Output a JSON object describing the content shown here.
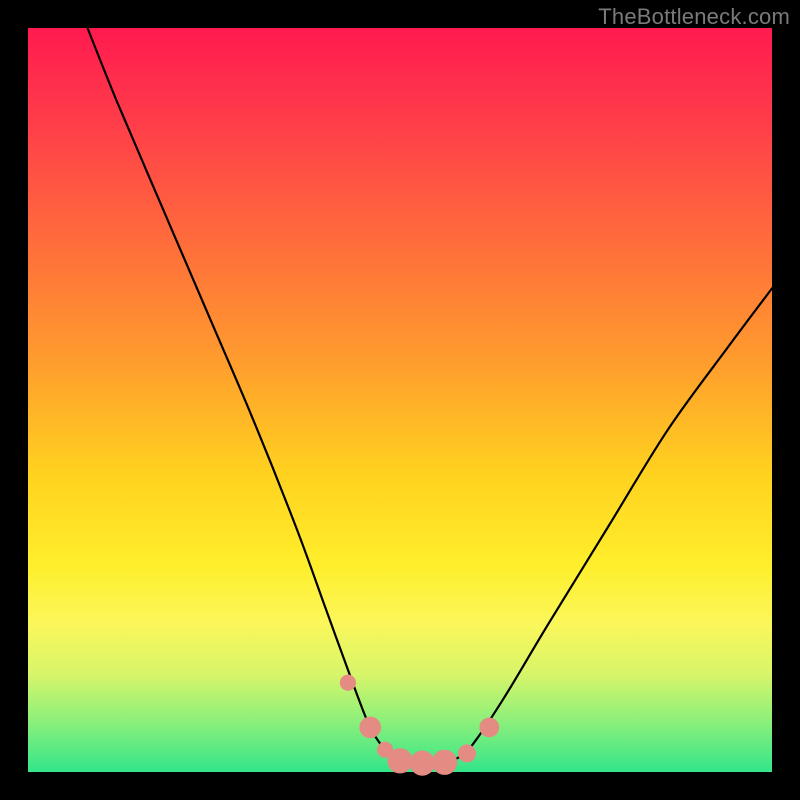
{
  "watermark": "TheBottleneck.com",
  "chart_data": {
    "type": "line",
    "title": "",
    "xlabel": "",
    "ylabel": "",
    "xlim": [
      0,
      100
    ],
    "ylim": [
      0,
      100
    ],
    "series": [
      {
        "name": "bottleneck-curve",
        "x": [
          8,
          12,
          18,
          24,
          30,
          36,
          40,
          44,
          46,
          48,
          50,
          52,
          55,
          58,
          60,
          64,
          70,
          78,
          86,
          94,
          100
        ],
        "values": [
          100,
          90,
          76,
          62,
          48,
          33,
          22,
          11,
          6,
          3,
          1.5,
          1.2,
          1.2,
          2,
          4,
          10,
          20,
          33,
          46,
          57,
          65
        ]
      }
    ],
    "markers": {
      "name": "highlight-dots",
      "color": "#e48b84",
      "points": [
        {
          "x": 43,
          "y": 12,
          "r": 1.8
        },
        {
          "x": 46,
          "y": 6,
          "r": 2.4
        },
        {
          "x": 48,
          "y": 3,
          "r": 1.8
        },
        {
          "x": 50,
          "y": 1.5,
          "r": 2.8
        },
        {
          "x": 53,
          "y": 1.2,
          "r": 2.8
        },
        {
          "x": 56,
          "y": 1.3,
          "r": 2.8
        },
        {
          "x": 59,
          "y": 2.5,
          "r": 2.0
        },
        {
          "x": 62,
          "y": 6,
          "r": 2.2
        }
      ]
    },
    "gradient_stops": [
      {
        "offset": 0,
        "color": "#ff1a4f"
      },
      {
        "offset": 12,
        "color": "#ff3b4a"
      },
      {
        "offset": 28,
        "color": "#ff6a3c"
      },
      {
        "offset": 44,
        "color": "#ff9a2e"
      },
      {
        "offset": 60,
        "color": "#ffd21f"
      },
      {
        "offset": 72,
        "color": "#ffee2b"
      },
      {
        "offset": 80,
        "color": "#fbf75a"
      },
      {
        "offset": 87,
        "color": "#d6f56a"
      },
      {
        "offset": 93,
        "color": "#8ef07a"
      },
      {
        "offset": 100,
        "color": "#33e58a"
      }
    ]
  }
}
